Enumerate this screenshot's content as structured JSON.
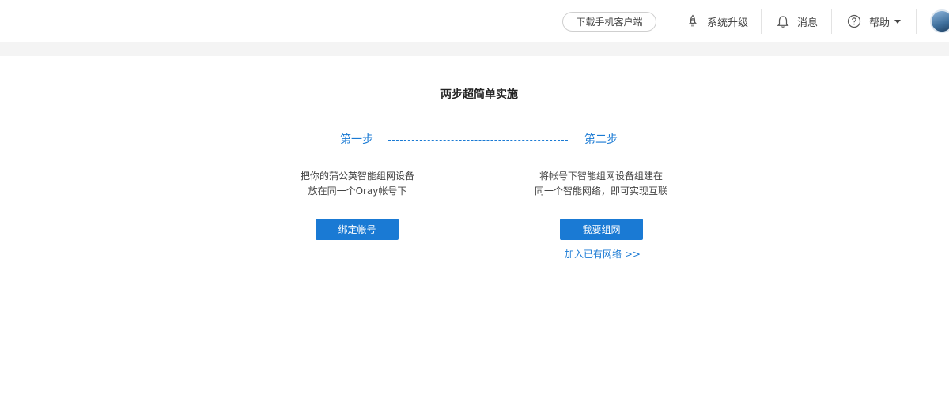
{
  "header": {
    "download_label": "下载手机客户端",
    "upgrade_label": "系统升级",
    "upgrade_icon": "rocket-icon",
    "messages_label": "消息",
    "messages_icon": "bell-icon",
    "help_label": "帮助",
    "help_icon": "question-circle-icon",
    "avatar_icon": "user-avatar"
  },
  "main": {
    "title": "两步超简单实施",
    "step1": {
      "label": "第一步",
      "line1": "把你的蒲公英智能组网设备",
      "line2": "放在同一个Oray帐号下",
      "button": "绑定帐号"
    },
    "step2": {
      "label": "第二步",
      "line1": "将帐号下智能组网设备组建在",
      "line2": "同一个智能网络，即可实现互联",
      "button": "我要组网",
      "link": "加入已有网络 >>"
    }
  },
  "colors": {
    "accent": "#1a7ad4",
    "band": "#f4f4f4",
    "text": "#333333"
  }
}
